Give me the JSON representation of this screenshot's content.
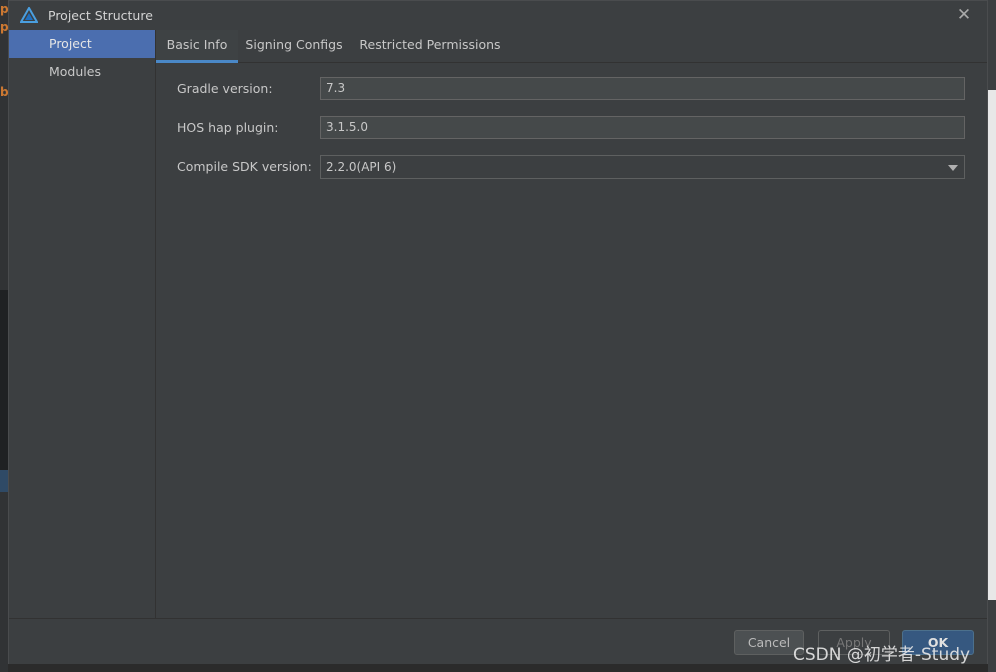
{
  "window": {
    "title": "Project Structure",
    "close_icon": "close-icon"
  },
  "sidebar": {
    "items": [
      {
        "label": "Project",
        "selected": true
      },
      {
        "label": "Modules",
        "selected": false
      }
    ]
  },
  "tabs": [
    {
      "label": "Basic Info",
      "active": true
    },
    {
      "label": "Signing Configs",
      "active": false
    },
    {
      "label": "Restricted Permissions",
      "active": false
    }
  ],
  "form": {
    "gradle_version": {
      "label": "Gradle version:",
      "value": "7.3"
    },
    "hos_hap_plugin": {
      "label": "HOS hap plugin:",
      "value": "3.1.5.0"
    },
    "compile_sdk_version": {
      "label": "Compile SDK version:",
      "value": "2.2.0(API 6)"
    }
  },
  "footer": {
    "cancel_label": "Cancel",
    "apply_label": "Apply",
    "ok_label": "OK"
  },
  "watermark": "CSDN @初学者-Study",
  "colors": {
    "selection": "#4b6eaf",
    "tab_underline": "#4a88c7",
    "primary_button": "#365880",
    "dialog_bg": "#3c3f41"
  }
}
